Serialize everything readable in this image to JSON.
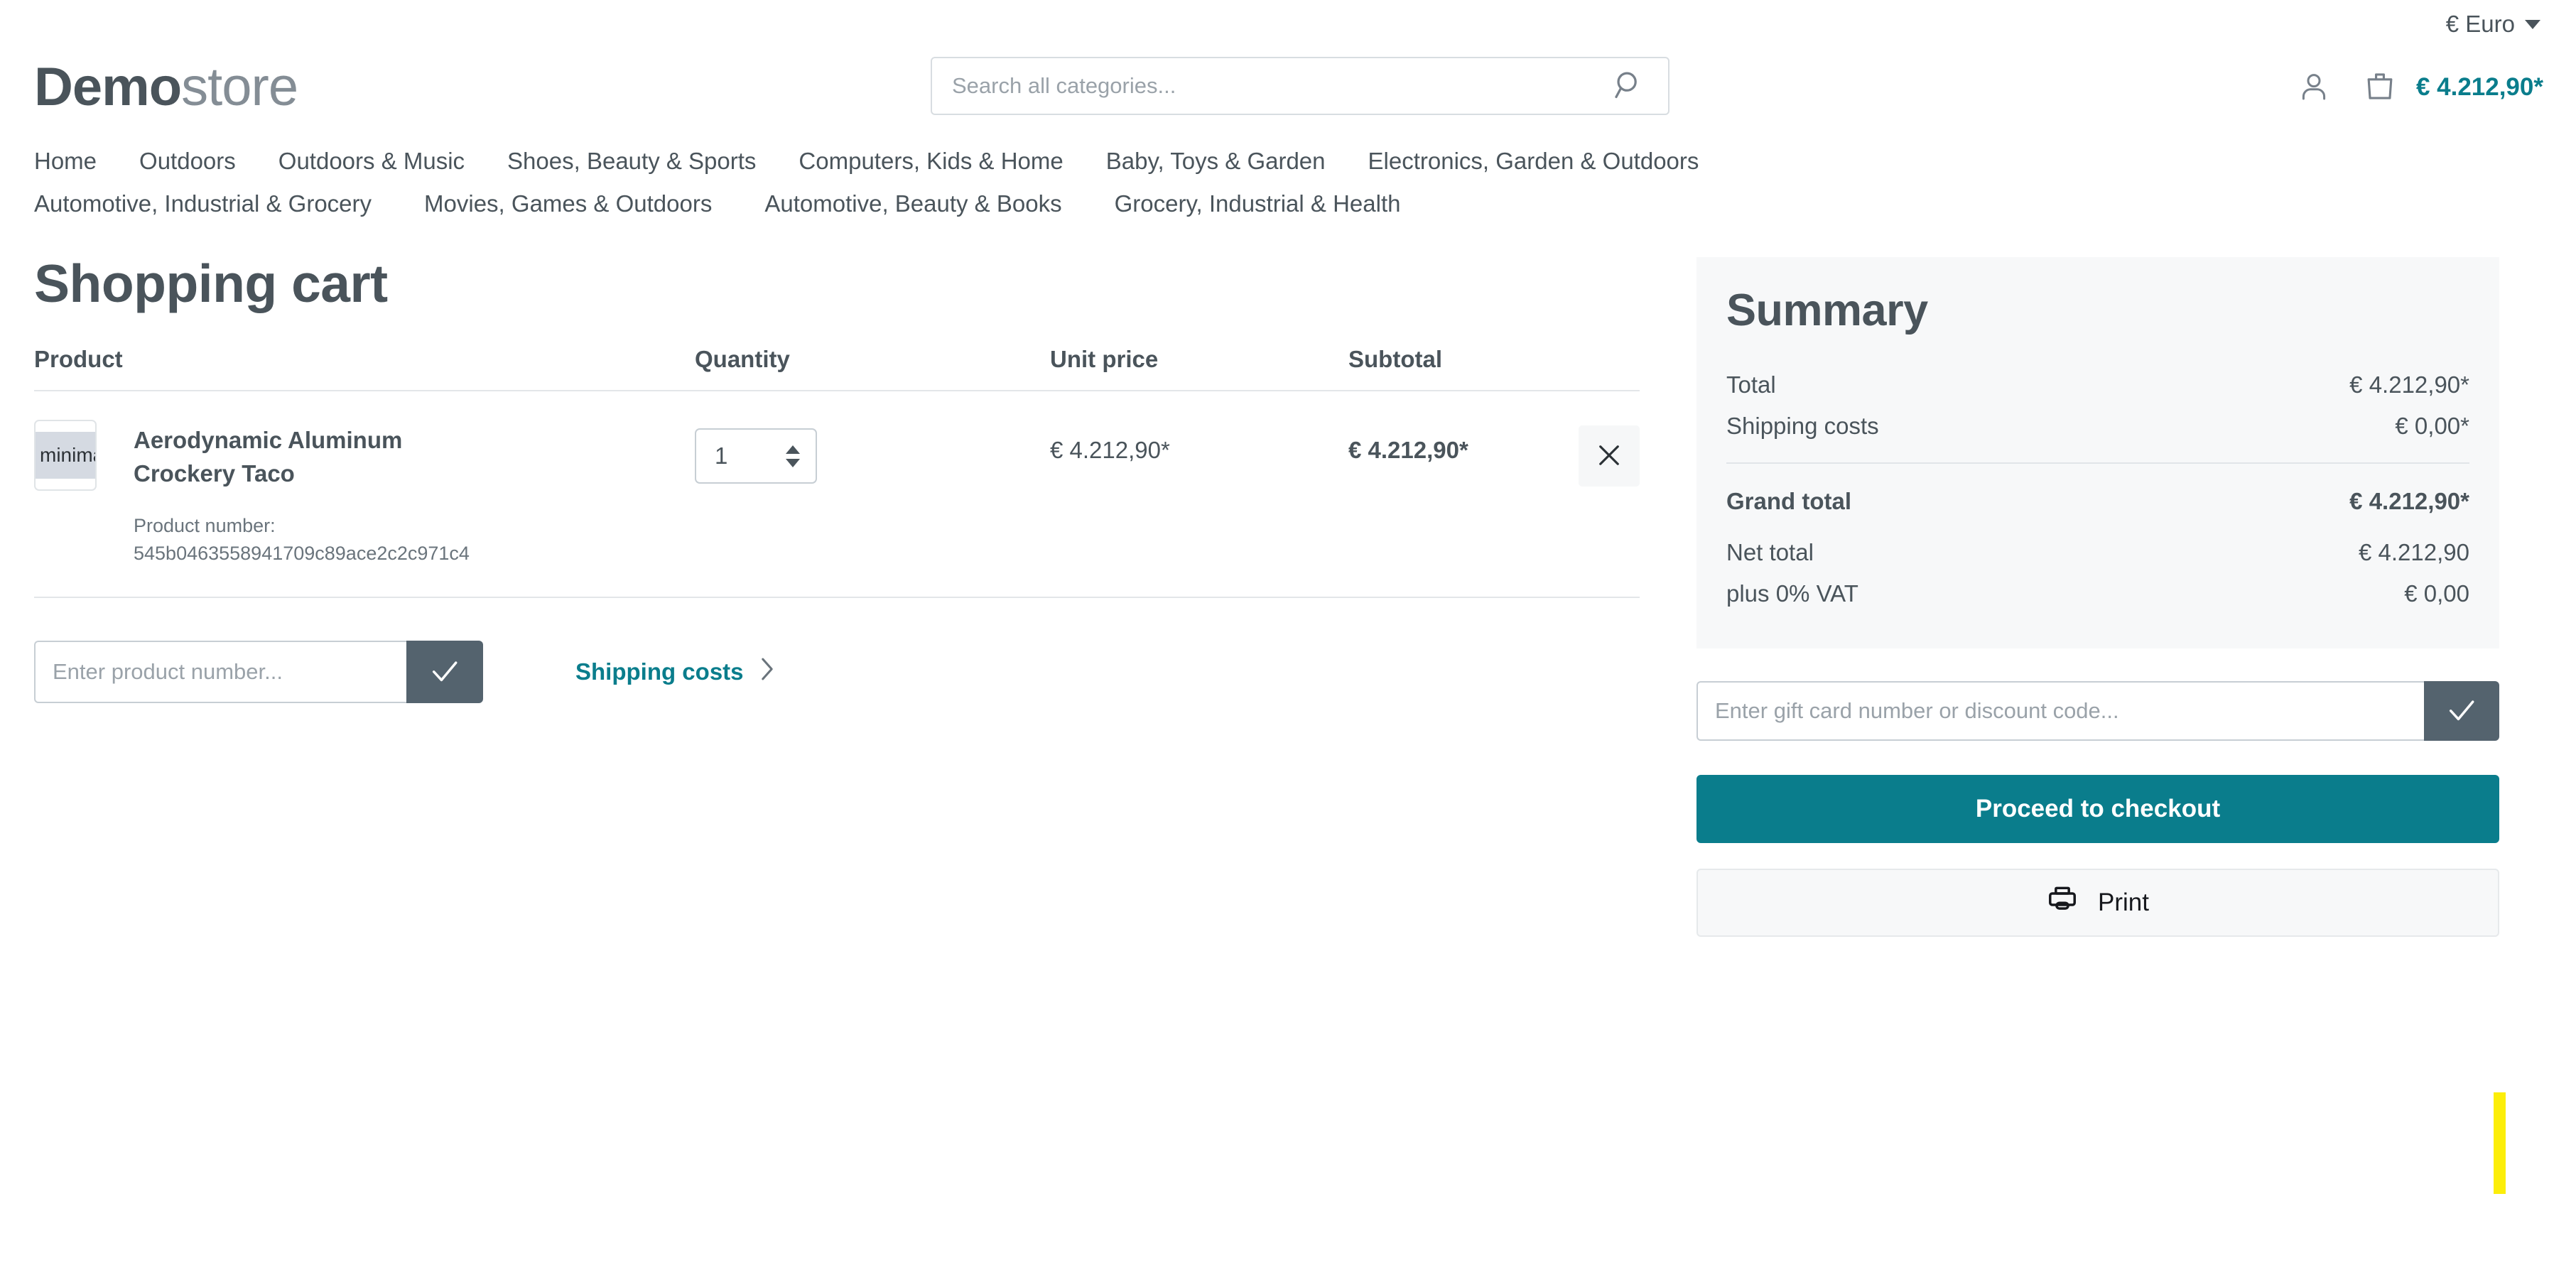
{
  "topbar": {
    "currency_label": "€ Euro",
    "caret_icon": "chevron-down-icon"
  },
  "header": {
    "logo_bold": "Demo",
    "logo_light": "store",
    "search": {
      "placeholder": "Search all categories...",
      "value": "",
      "icon": "search-icon"
    },
    "account_icon": "user-icon",
    "cart_icon": "shopping-bag-icon",
    "cart_amount": "€ 4.212,90*"
  },
  "nav": {
    "row1": [
      "Home",
      "Outdoors",
      "Outdoors & Music",
      "Shoes, Beauty & Sports",
      "Computers, Kids & Home",
      "Baby, Toys & Garden",
      "Electronics, Garden & Outdoors"
    ],
    "row2": [
      "Automotive, Industrial & Grocery",
      "Movies, Games & Outdoors",
      "Automotive, Beauty & Books",
      "Grocery, Industrial & Health"
    ]
  },
  "cart": {
    "title": "Shopping cart",
    "columns": {
      "product": "Product",
      "quantity": "Quantity",
      "unit_price": "Unit price",
      "subtotal": "Subtotal"
    },
    "items": [
      {
        "thumb_text": "minima",
        "name": "Aerodynamic Aluminum Crockery Taco",
        "product_number_label": "Product number:",
        "product_number": "545b0463558941709c89ace2c2c971c4",
        "quantity": "1",
        "unit_price": "€ 4.212,90*",
        "subtotal": "€ 4.212,90*",
        "remove_icon": "close-icon"
      }
    ],
    "product_number_input": {
      "placeholder": "Enter product number...",
      "value": "",
      "submit_icon": "check-icon"
    },
    "shipping_costs_link": "Shipping costs",
    "shipping_chevron_icon": "chevron-right-icon"
  },
  "summary": {
    "title": "Summary",
    "rows": [
      {
        "label": "Total",
        "value": "€ 4.212,90*"
      },
      {
        "label": "Shipping costs",
        "value": "€ 0,00*"
      }
    ],
    "grand_total": {
      "label": "Grand total",
      "value": "€ 4.212,90*"
    },
    "net_rows": [
      {
        "label": "Net total",
        "value": "€ 4.212,90"
      },
      {
        "label": "plus 0% VAT",
        "value": "€ 0,00"
      }
    ],
    "voucher": {
      "placeholder": "Enter gift card number or discount code...",
      "value": "",
      "submit_icon": "check-icon"
    },
    "checkout_label": "Proceed to checkout",
    "print_label": "Print",
    "print_icon": "printer-icon"
  },
  "colors": {
    "accent_teal": "#0a7d8c",
    "text_slate": "#4a545b",
    "button_slate": "#54636e",
    "panel_bg": "#f7f8f9",
    "marker_yellow": "#fcee09"
  }
}
